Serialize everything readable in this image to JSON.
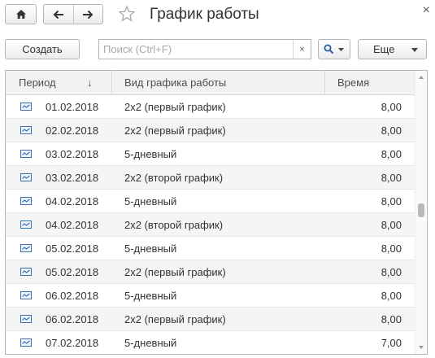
{
  "header": {
    "title": "График работы",
    "close_label": "×"
  },
  "toolbar": {
    "create_label": "Создать",
    "search_placeholder": "Поиск (Ctrl+F)",
    "search_clear_label": "×",
    "more_label": "Еще"
  },
  "table": {
    "columns": [
      "Период",
      "Вид графика работы",
      "Время"
    ],
    "sort_indicator": "↓",
    "rows": [
      {
        "date": "01.02.2018",
        "type": "2х2 (первый график)",
        "time": "8,00"
      },
      {
        "date": "02.02.2018",
        "type": "2х2 (первый график)",
        "time": "8,00"
      },
      {
        "date": "03.02.2018",
        "type": "5-дневный",
        "time": "8,00"
      },
      {
        "date": "03.02.2018",
        "type": "2х2 (второй график)",
        "time": "8,00"
      },
      {
        "date": "04.02.2018",
        "type": "5-дневный",
        "time": "8,00"
      },
      {
        "date": "04.02.2018",
        "type": "2х2 (второй график)",
        "time": "8,00"
      },
      {
        "date": "05.02.2018",
        "type": "5-дневный",
        "time": "8,00"
      },
      {
        "date": "05.02.2018",
        "type": "2х2 (первый график)",
        "time": "8,00"
      },
      {
        "date": "06.02.2018",
        "type": "5-дневный",
        "time": "8,00"
      },
      {
        "date": "06.02.2018",
        "type": "2х2 (первый график)",
        "time": "8,00"
      },
      {
        "date": "07.02.2018",
        "type": "5-дневный",
        "time": "7,00"
      }
    ]
  },
  "icons": {
    "home": "home-icon",
    "back": "arrow-left-icon",
    "forward": "arrow-right-icon",
    "favorite": "star-icon",
    "search": "magnifier-icon",
    "row": "register-record-icon"
  },
  "colors": {
    "row_icon": "#3a6fb0",
    "header_bg": "#f2f2f2",
    "stripe_bg": "#f5f5f5"
  }
}
